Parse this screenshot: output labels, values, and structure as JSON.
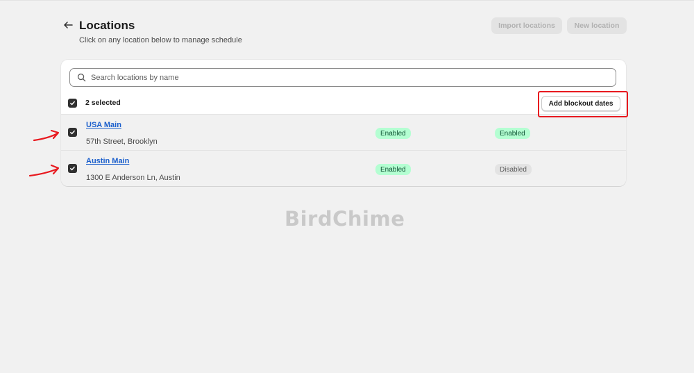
{
  "header": {
    "title": "Locations",
    "subtitle": "Click on any location below to manage schedule",
    "import_label": "Import locations",
    "new_label": "New location"
  },
  "search": {
    "placeholder": "Search locations by name"
  },
  "bulk": {
    "selected_label": "2 selected",
    "blockout_label": "Add blockout dates"
  },
  "locations": [
    {
      "name": "USA Main",
      "address": "57th Street, Brooklyn",
      "status_a": "Enabled",
      "status_b": "Enabled",
      "checked": true
    },
    {
      "name": "Austin Main",
      "address": "1300 E Anderson Ln, Austin",
      "status_a": "Enabled",
      "status_b": "Disabled",
      "checked": true
    }
  ],
  "watermark": "BirdChime",
  "icons": {
    "back": "arrow-left-icon",
    "search": "search-icon",
    "checkbox": "checkmark-icon"
  },
  "colors": {
    "enabled_bg": "#b4fed2",
    "disabled_bg": "#e3e3e3",
    "link": "#1b5fcc",
    "annotation": "#e8191f"
  }
}
